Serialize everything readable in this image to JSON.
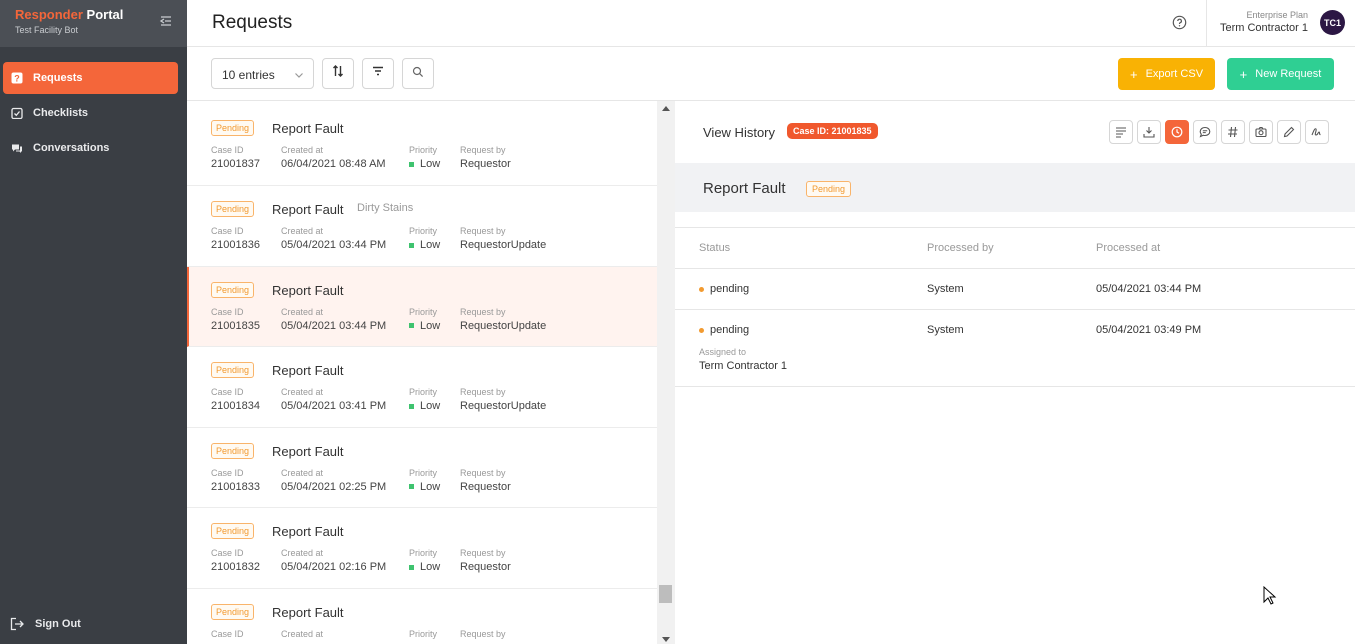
{
  "brand": {
    "name_accent": "Responder",
    "name_rest": " Portal",
    "subtitle": "Test Facility Bot"
  },
  "sidebar": {
    "items": [
      {
        "label": "Requests",
        "icon": "question-square-icon",
        "active": true
      },
      {
        "label": "Checklists",
        "icon": "checklist-icon",
        "active": false
      },
      {
        "label": "Conversations",
        "icon": "chat-icon",
        "active": false
      }
    ],
    "sign_out": "Sign Out"
  },
  "header": {
    "title": "Requests",
    "plan": "Enterprise Plan",
    "account_name": "Term Contractor 1",
    "avatar_initials": "TC1"
  },
  "toolbar": {
    "entries_value": "10 entries",
    "export_label": "Export CSV",
    "new_label": "New Request",
    "colors": {
      "export": "#f9b204",
      "new": "#2fcf93",
      "accent": "#f4663a"
    }
  },
  "list": {
    "labels": {
      "case_id": "Case ID",
      "created_at": "Created at",
      "priority": "Priority",
      "request_by": "Request by"
    },
    "rows": [
      {
        "status": "Pending",
        "title": "Report Fault",
        "tag": "",
        "case_id": "21001837",
        "created_at": "06/04/2021 08:48 AM",
        "priority": "Low",
        "request_by": "Requestor"
      },
      {
        "status": "Pending",
        "title": "Report Fault",
        "tag": "Dirty Stains",
        "case_id": "21001836",
        "created_at": "05/04/2021 03:44 PM",
        "priority": "Low",
        "request_by": "RequestorUpdate"
      },
      {
        "status": "Pending",
        "title": "Report Fault",
        "tag": "",
        "case_id": "21001835",
        "created_at": "05/04/2021 03:44 PM",
        "priority": "Low",
        "request_by": "RequestorUpdate",
        "selected": true
      },
      {
        "status": "Pending",
        "title": "Report Fault",
        "tag": "",
        "case_id": "21001834",
        "created_at": "05/04/2021 03:41 PM",
        "priority": "Low",
        "request_by": "RequestorUpdate"
      },
      {
        "status": "Pending",
        "title": "Report Fault",
        "tag": "",
        "case_id": "21001833",
        "created_at": "05/04/2021 02:25 PM",
        "priority": "Low",
        "request_by": "Requestor"
      },
      {
        "status": "Pending",
        "title": "Report Fault",
        "tag": "",
        "case_id": "21001832",
        "created_at": "05/04/2021 02:16 PM",
        "priority": "Low",
        "request_by": "Requestor"
      },
      {
        "status": "Pending",
        "title": "Report Fault",
        "tag": "",
        "case_id": "",
        "created_at": "",
        "priority": "",
        "request_by": ""
      }
    ]
  },
  "detail": {
    "view_history": "View History",
    "case_chip": "Case ID: 21001835",
    "tools": [
      "details-icon",
      "download-icon",
      "history-icon",
      "comment-icon",
      "hash-icon",
      "camera-icon",
      "edit-icon",
      "signature-icon"
    ],
    "title": "Report Fault",
    "status": "Pending",
    "columns": {
      "status": "Status",
      "processed_by": "Processed by",
      "processed_at": "Processed at"
    },
    "history": [
      {
        "status": "pending",
        "processed_by": "System",
        "processed_at": "05/04/2021 03:44 PM"
      },
      {
        "status": "pending",
        "processed_by": "System",
        "processed_at": "05/04/2021 03:49 PM",
        "assigned_label": "Assigned to",
        "assigned_to": "Term Contractor 1"
      }
    ]
  }
}
